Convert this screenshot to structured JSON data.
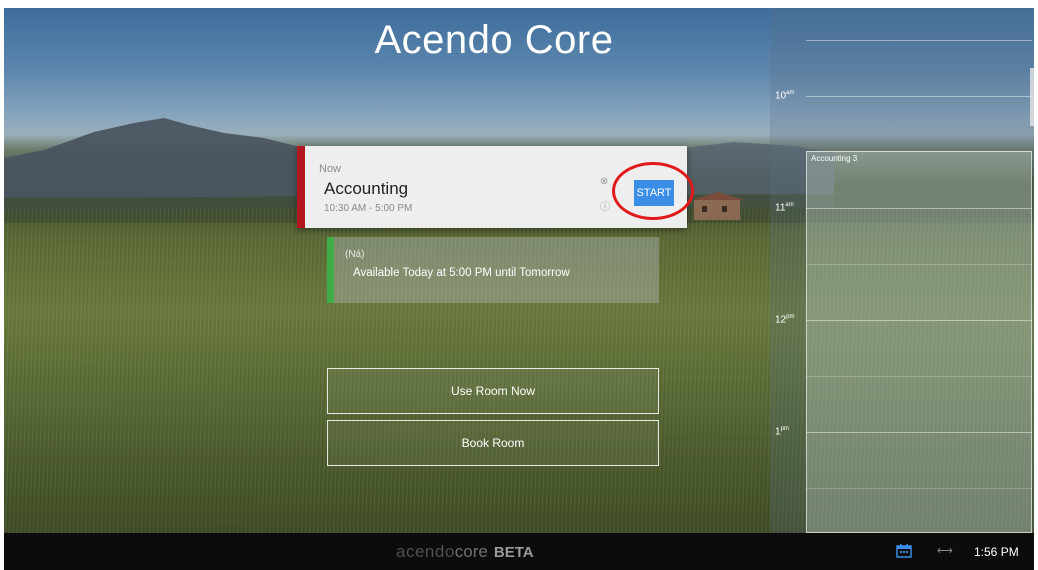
{
  "app": {
    "title": "Acendo Core"
  },
  "current_meeting": {
    "label": "Now",
    "title": "Accounting",
    "time": "10:30 AM - 5:00 PM",
    "start_button_label": "START",
    "status_color": "#b2171f"
  },
  "next_status": {
    "label": "(Ná)",
    "text": "Available Today at 5:00 PM until Tomorrow",
    "status_color": "#3fae49"
  },
  "actions": {
    "use_room_label": "Use Room Now",
    "book_room_label": "Book Room"
  },
  "agenda": {
    "hours": [
      {
        "label": "10",
        "suffix": "am"
      },
      {
        "label": "11",
        "suffix": "am"
      },
      {
        "label": "12",
        "suffix": "pm"
      },
      {
        "label": "1",
        "suffix": "pm"
      }
    ],
    "event_title": "Accounting 3"
  },
  "taskbar": {
    "brand_light": "acendo",
    "brand_core": "core",
    "brand_beta": "BETA",
    "time": "1:56 PM",
    "calendar_icon": "calendar-icon",
    "switch_icon": "arrows-horizontal-icon"
  },
  "colors": {
    "start_button": "#3a8ee6",
    "highlight": "#e0191b"
  }
}
